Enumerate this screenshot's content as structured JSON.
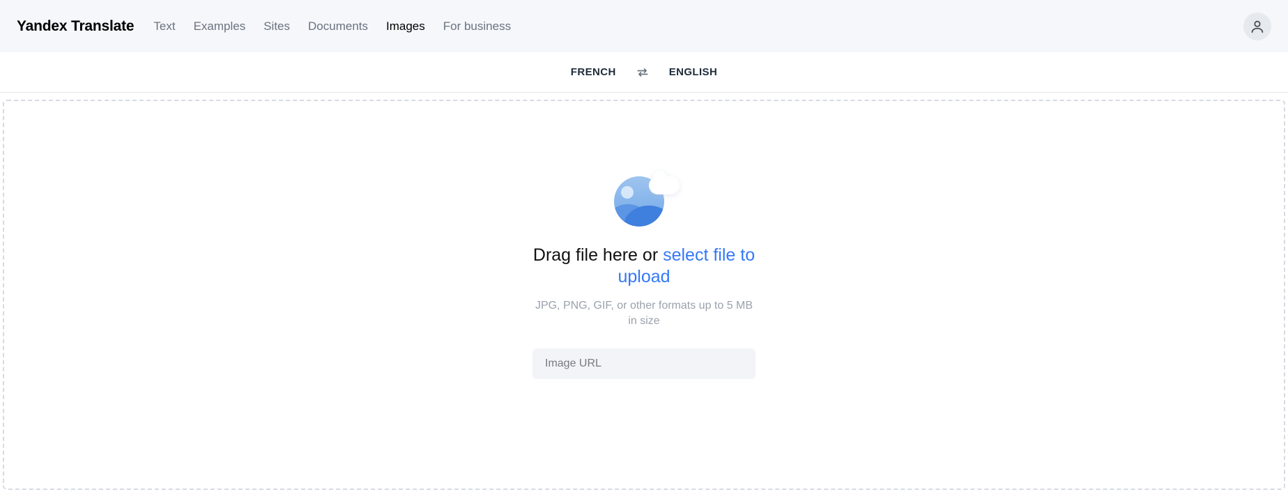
{
  "header": {
    "logo": "Yandex Translate",
    "nav": [
      {
        "label": "Text",
        "active": false
      },
      {
        "label": "Examples",
        "active": false
      },
      {
        "label": "Sites",
        "active": false
      },
      {
        "label": "Documents",
        "active": false
      },
      {
        "label": "Images",
        "active": true
      },
      {
        "label": "For business",
        "active": false
      }
    ]
  },
  "langbar": {
    "source": "FRENCH",
    "target": "ENGLISH"
  },
  "drop": {
    "title_prefix": "Drag file here or ",
    "title_link": "select file to upload",
    "subtitle": "JPG, PNG, GIF, or other formats up to 5 MB in size",
    "url_placeholder": "Image URL"
  }
}
